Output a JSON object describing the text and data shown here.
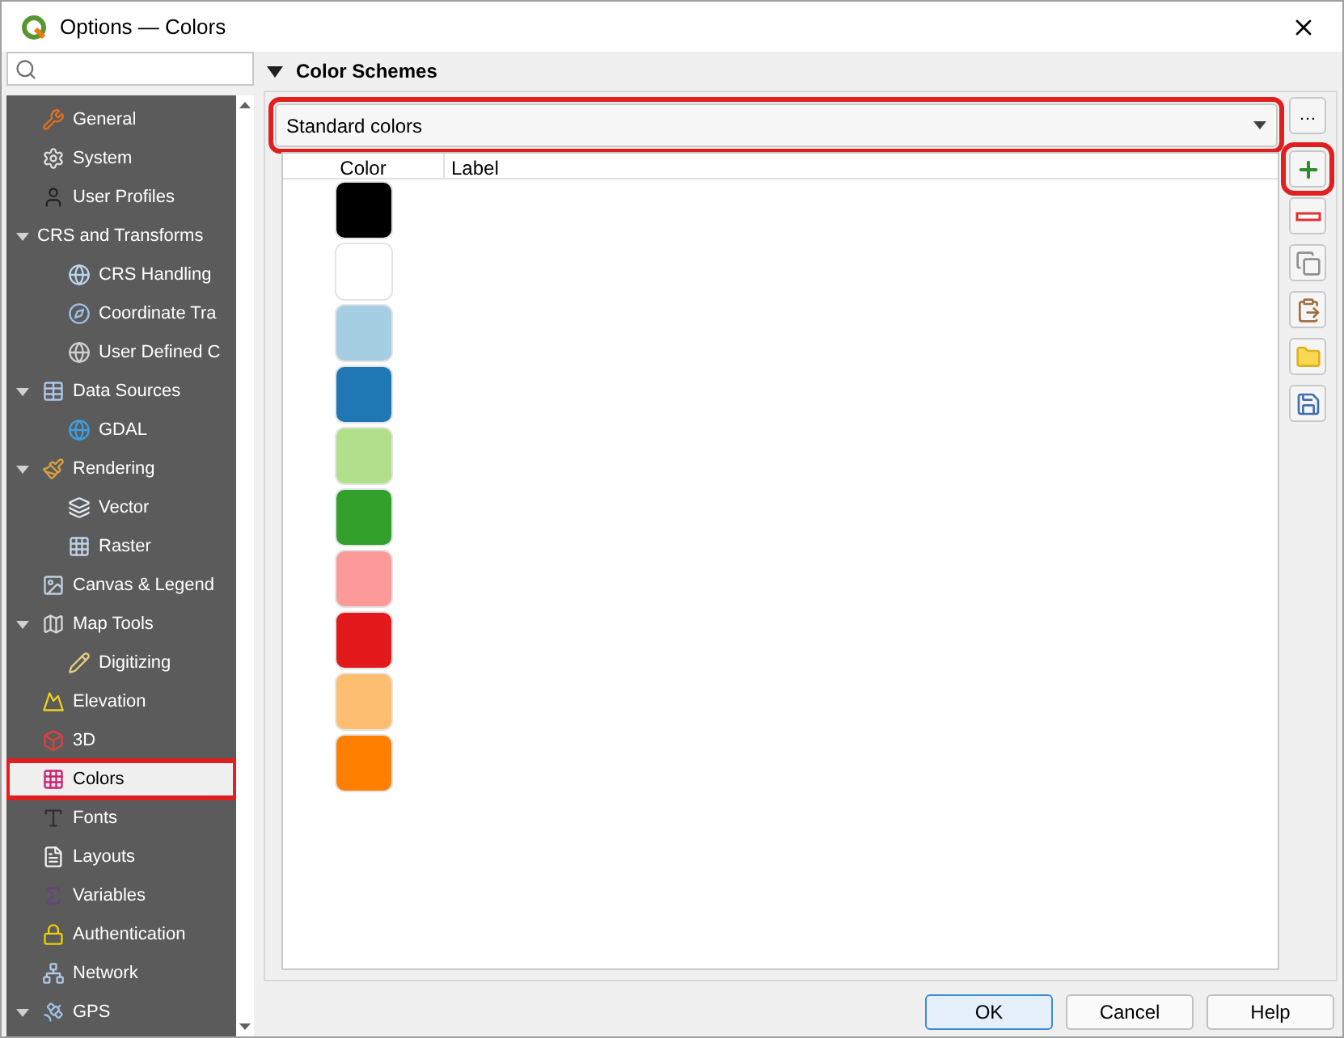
{
  "window": {
    "title": "Options — Colors"
  },
  "sidebar": {
    "items": [
      {
        "label": "General",
        "selected": false
      },
      {
        "label": "System",
        "selected": false
      },
      {
        "label": "User Profiles",
        "selected": false
      },
      {
        "label": "CRS and Transforms",
        "selected": false,
        "expanded": true,
        "children": [
          {
            "label": "CRS Handling",
            "selected": false
          },
          {
            "label": "Coordinate Tra",
            "selected": false
          },
          {
            "label": "User Defined C",
            "selected": false
          }
        ]
      },
      {
        "label": "Data Sources",
        "selected": false,
        "expanded": true,
        "children": [
          {
            "label": "GDAL",
            "selected": false
          }
        ]
      },
      {
        "label": "Rendering",
        "selected": false,
        "expanded": true,
        "children": [
          {
            "label": "Vector",
            "selected": false
          },
          {
            "label": "Raster",
            "selected": false
          }
        ]
      },
      {
        "label": "Canvas & Legend",
        "selected": false
      },
      {
        "label": "Map Tools",
        "selected": false,
        "expanded": true,
        "children": [
          {
            "label": "Digitizing",
            "selected": false
          }
        ]
      },
      {
        "label": "Elevation",
        "selected": false
      },
      {
        "label": "3D",
        "selected": false
      },
      {
        "label": "Colors",
        "selected": true,
        "highlighted": true
      },
      {
        "label": "Fonts",
        "selected": false
      },
      {
        "label": "Layouts",
        "selected": false
      },
      {
        "label": "Variables",
        "selected": false
      },
      {
        "label": "Authentication",
        "selected": false
      },
      {
        "label": "Network",
        "selected": false
      },
      {
        "label": "GPS",
        "selected": false,
        "expanded": true
      }
    ]
  },
  "section": {
    "title": "Color Schemes",
    "expanded": true
  },
  "scheme_select": {
    "value": "Standard colors",
    "highlighted": true
  },
  "table": {
    "columns": [
      "Color",
      "Label"
    ],
    "rows": [
      {
        "color": "#000000"
      },
      {
        "color": "#ffffff"
      },
      {
        "color": "#a6cee3"
      },
      {
        "color": "#1f78b4"
      },
      {
        "color": "#b2df8a"
      },
      {
        "color": "#33a02c"
      },
      {
        "color": "#fb9a99"
      },
      {
        "color": "#e31a1c"
      },
      {
        "color": "#fdbf6f"
      },
      {
        "color": "#ff7f00"
      }
    ]
  },
  "tools": [
    {
      "kind": "menu",
      "label": "…"
    },
    {
      "kind": "add",
      "highlighted": true
    },
    {
      "kind": "remove"
    },
    {
      "kind": "copy"
    },
    {
      "kind": "paste"
    },
    {
      "kind": "open"
    },
    {
      "kind": "save"
    }
  ],
  "buttons": [
    {
      "label": "OK",
      "default": true
    },
    {
      "label": "Cancel",
      "default": false
    },
    {
      "label": "Help",
      "default": false
    }
  ]
}
